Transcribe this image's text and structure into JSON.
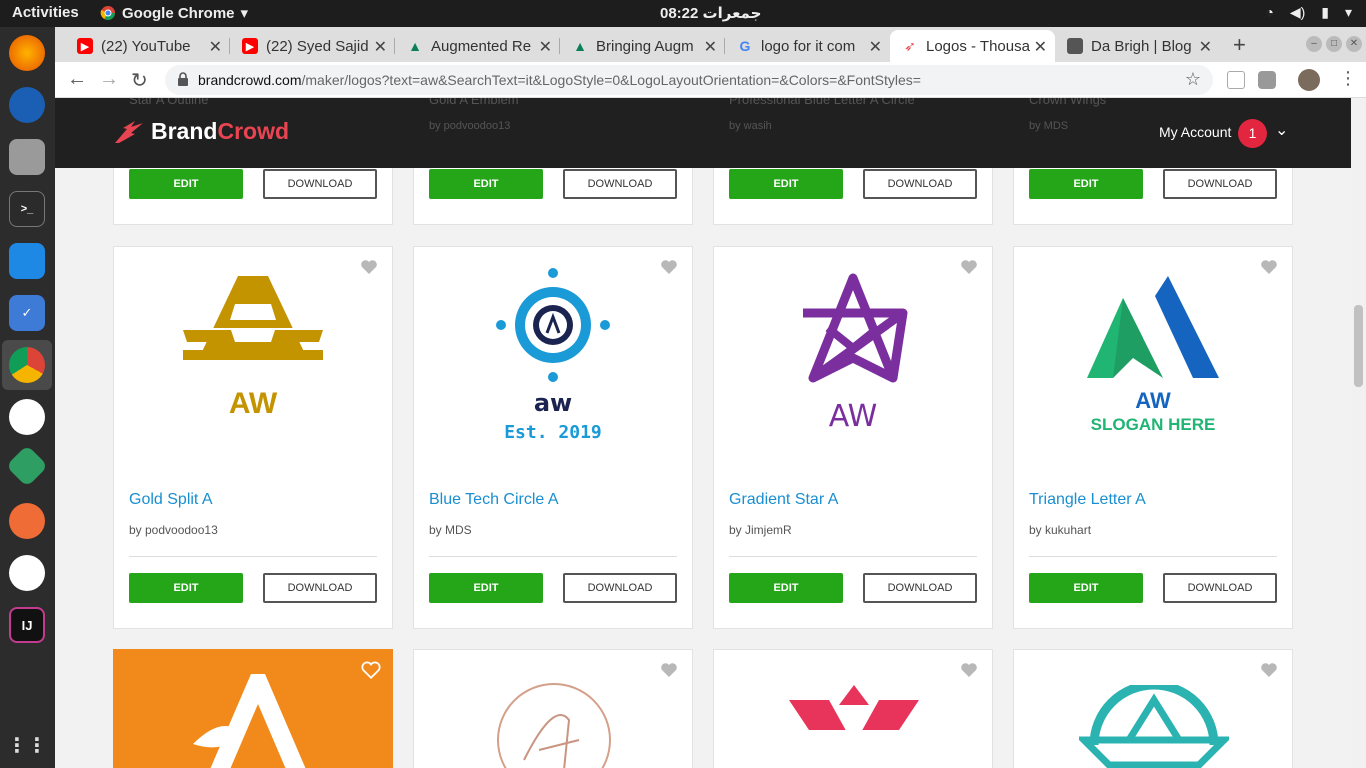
{
  "os": {
    "activities": "Activities",
    "app_name": "Google Chrome",
    "clock": "جمعرات 08:22"
  },
  "browser": {
    "tabs": [
      {
        "title": "(22) YouTube",
        "icon": "youtube-icon"
      },
      {
        "title": "(22) Syed Sajid",
        "icon": "youtube-icon"
      },
      {
        "title": "Augmented Re",
        "icon": "augment-icon"
      },
      {
        "title": "Bringing Augm",
        "icon": "augment-icon"
      },
      {
        "title": "logo for it com",
        "icon": "google-icon"
      },
      {
        "title": "Logos - Thousa",
        "icon": "brandcrowd-icon",
        "active": true
      },
      {
        "title": "Da Brigh | Blog",
        "icon": "blog-icon"
      }
    ],
    "url_host": "brandcrowd.com",
    "url_path": "/maker/logos?text=aw&SearchText=it&LogoStyle=0&LogoLayoutOrientation=&Colors=&FontStyles="
  },
  "site": {
    "brand_a": "Brand",
    "brand_b": "Crowd",
    "account_label": "My Account",
    "notification_count": "1",
    "ghost_titles": [
      "Star A Outline",
      "Gold A Emblem",
      "Professional Blue Letter A Circle",
      "Crown Wings"
    ],
    "ghost_authors": [
      "by podvoodoo13",
      "by podvoodoo13",
      "by wasih",
      "by MDS"
    ]
  },
  "labels": {
    "edit": "EDIT",
    "download": "DOWNLOAD"
  },
  "cards": [
    {
      "name": "Gold Split A",
      "author": "by podvoodoo13",
      "logo_text": "AW"
    },
    {
      "name": "Blue Tech Circle A",
      "author": "by MDS",
      "logo_text": "aw",
      "logo_sub": "Est. 2019"
    },
    {
      "name": "Gradient Star A",
      "author": "by JimjemR",
      "logo_text": "AW"
    },
    {
      "name": "Triangle Letter A",
      "author": "by kukuhart",
      "logo_text": "AW",
      "logo_sub": "SLOGAN HERE"
    }
  ],
  "colors": {
    "edit_green": "#25a518",
    "link_blue": "#1a8fd0",
    "brand_red": "#e94451",
    "gold": "#c39300",
    "tech_blue": "#1a9ad6",
    "navy": "#1b2450",
    "purple": "#7b2f9f",
    "triangle_blue": "#1565c0",
    "triangle_green": "#21b574",
    "orange": "#f28a1b"
  }
}
